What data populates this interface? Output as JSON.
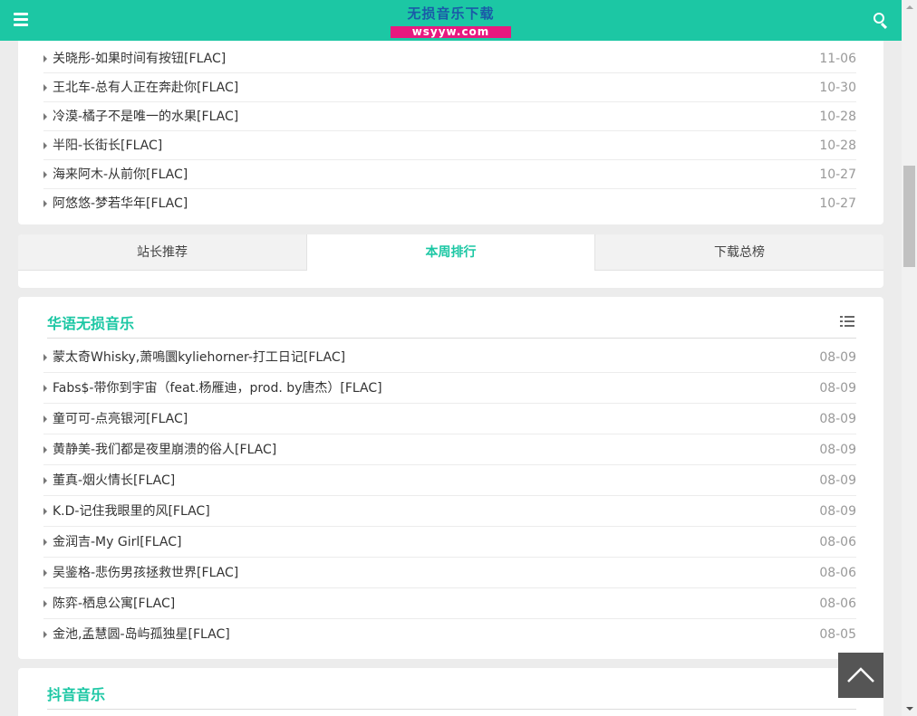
{
  "header": {
    "logo_title": "无损音乐下载",
    "logo_sub": "wsyyw.com",
    "menu_icon": "hamburger-icon",
    "search_icon": "search-icon",
    "bg_color": "#1cc7a4"
  },
  "latest": {
    "items": [
      {
        "title": "关晓彤-如果时间有按钮[FLAC]",
        "date": "11-06"
      },
      {
        "title": "王北车-总有人正在奔赴你[FLAC]",
        "date": "10-30"
      },
      {
        "title": "冷漠-橘子不是唯一的水果[FLAC]",
        "date": "10-28"
      },
      {
        "title": "半阳-长街长[FLAC]",
        "date": "10-28"
      },
      {
        "title": "海来阿木-从前你[FLAC]",
        "date": "10-27"
      },
      {
        "title": "阿悠悠-梦若华年[FLAC]",
        "date": "10-27"
      }
    ]
  },
  "tabs": [
    {
      "label": "站长推荐",
      "active": false
    },
    {
      "label": "本周排行",
      "active": true
    },
    {
      "label": "下载总榜",
      "active": false
    }
  ],
  "sections": [
    {
      "title": "华语无损音乐",
      "icon": "list-icon",
      "items": [
        {
          "title": "蒙太奇Whisky,萧鳴圜kyliehorner-打工日记[FLAC]",
          "date": "08-09"
        },
        {
          "title": "Fabs$-带你到宇宙（feat.杨雁迪，prod. by唐杰）[FLAC]",
          "date": "08-09"
        },
        {
          "title": "童可可-点亮银河[FLAC]",
          "date": "08-09"
        },
        {
          "title": "黄静美-我们都是夜里崩溃的俗人[FLAC]",
          "date": "08-09"
        },
        {
          "title": "董真-烟火情长[FLAC]",
          "date": "08-09"
        },
        {
          "title": "K.D-记住我眼里的风[FLAC]",
          "date": "08-09"
        },
        {
          "title": "金润吉-My Girl[FLAC]",
          "date": "08-06"
        },
        {
          "title": "吴鉴格-悲伤男孩拯救世界[FLAC]",
          "date": "08-06"
        },
        {
          "title": "陈弈-栖息公寓[FLAC]",
          "date": "08-06"
        },
        {
          "title": "金池,孟慧圆-岛屿孤独星[FLAC]",
          "date": "08-05"
        }
      ]
    },
    {
      "title": "抖音音乐",
      "icon": "list-icon"
    }
  ],
  "backtop_icon": "chevron-up-icon",
  "accent_color": "#1cc7a4"
}
